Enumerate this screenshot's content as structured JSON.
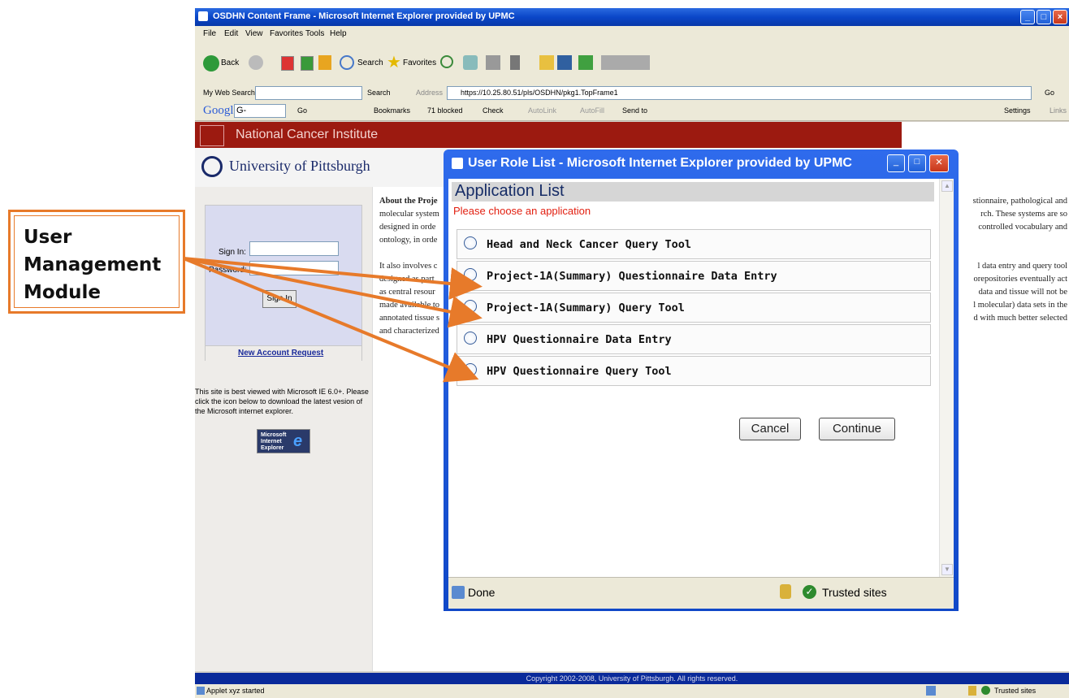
{
  "callout": {
    "line1": "User",
    "line2": "Management",
    "line3": "Module"
  },
  "browser": {
    "title": "OSDHN Content Frame - Microsoft Internet Explorer provided by UPMC",
    "menu": [
      "File",
      "Edit",
      "View",
      "Favorites",
      "Tools",
      "Help"
    ],
    "toolbar": {
      "back": "Back",
      "search": "Search",
      "favorites": "Favorites"
    },
    "address_bar": {
      "my_web_search": "My Web Search",
      "search_btn": "Search",
      "address_label": "Address",
      "url": "https://10.25.80.51/pls/OSDHN/pkg1.TopFrame1",
      "go": "Go"
    },
    "google_bar": {
      "logo": "Google",
      "g_menu": "G-",
      "go": "Go",
      "bookmarks": "Bookmarks",
      "blocked": "71 blocked",
      "check": "Check",
      "autolink": "AutoLink",
      "autofill": "AutoFill",
      "send_to": "Send to",
      "settings": "Settings",
      "links": "Links"
    },
    "status": {
      "text": "Applet xyz started",
      "zone": "Trusted sites"
    },
    "copyright": "Copyright 2002-2008, University of Pittsburgh. All rights reserved."
  },
  "page": {
    "nci": "National Cancer Institute",
    "pitt": "University of Pittsburgh",
    "sign_in_label": "Sign In:",
    "password_label": "Password:",
    "sign_in_button": "Sign In",
    "new_account": "New Account Request",
    "ie_note": "This site is best viewed with Microsoft IE 6.0+. Please click the icon below to download the latest vesion of the Microsoft internet explorer.",
    "ie_logo": "Microsoft Internet Explorer",
    "about_left": [
      "About the Proje",
      "molecular system",
      "designed in orde",
      "ontology, in orde",
      "",
      "It also involves c",
      "designed as part",
      "as central resour",
      "made available to",
      "annotated tissue s",
      "and characterized"
    ],
    "about_right": [
      "stionnaire, pathological and",
      "rch. These systems are so",
      "controlled vocabulary and",
      "",
      "",
      "l data entry and query tool",
      "orepositories eventually act",
      "data and tissue will not be",
      "l molecular) data sets in the",
      "d with much better selected"
    ]
  },
  "popup": {
    "title": "User Role List - Microsoft Internet Explorer provided by UPMC",
    "header": "Application List",
    "subheader": "Please choose an application",
    "apps": [
      "Head and Neck Cancer Query Tool",
      "Project-1A(Summary) Questionnaire Data Entry",
      "Project-1A(Summary) Query Tool",
      "HPV Questionnaire Data Entry",
      "HPV Questionnaire Query Tool"
    ],
    "cancel": "Cancel",
    "continue": "Continue",
    "status_done": "Done",
    "status_zone": "Trusted sites"
  },
  "colors": {
    "accent": "#e77a2a",
    "nci_red": "#9c1a10",
    "xp_blue": "#0a46c8",
    "subheader": "#e21f10"
  }
}
